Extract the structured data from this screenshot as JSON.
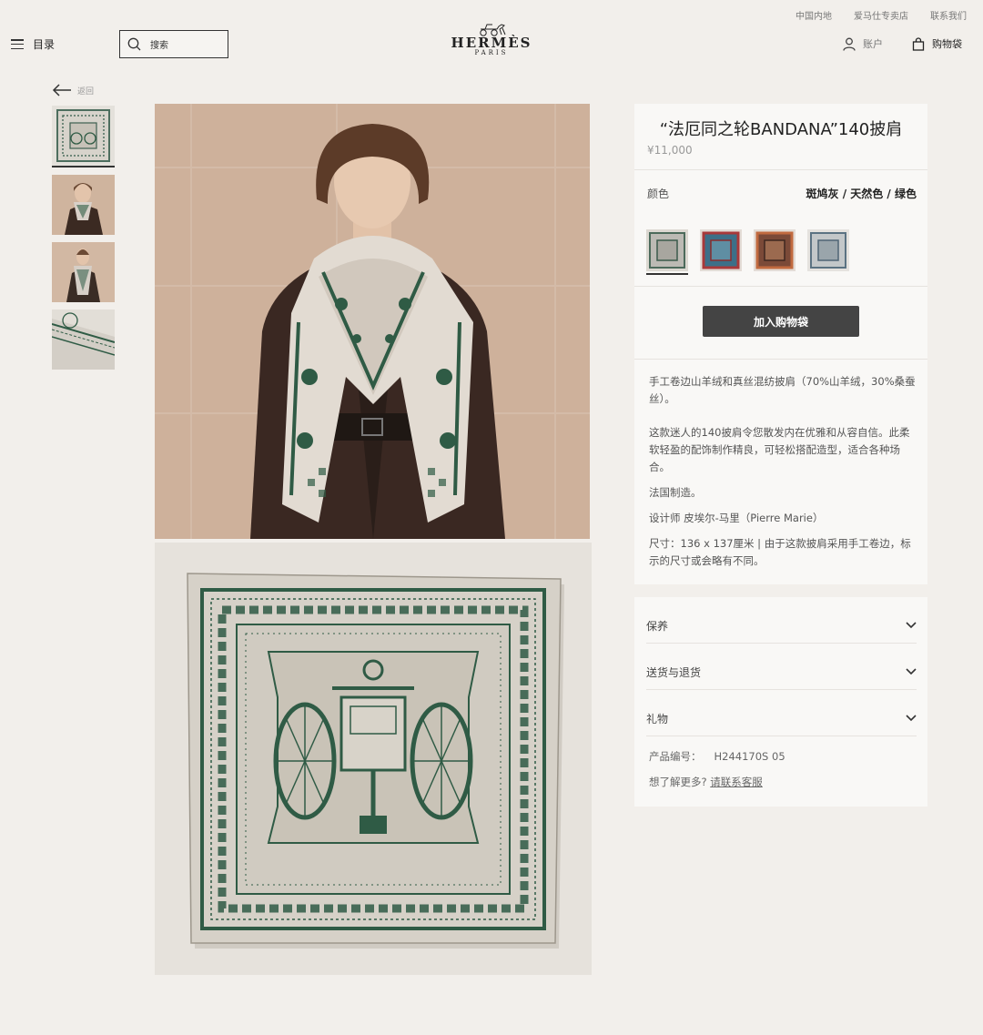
{
  "util_links": [
    "中国内地",
    "爱马仕专卖店",
    "联系我们"
  ],
  "header": {
    "menu_label": "目录",
    "search_placeholder": "搜索",
    "brand": "HERMÈS",
    "city": "PARIS",
    "account_label": "账户",
    "bag_label": "购物袋"
  },
  "back_label": "返回",
  "product": {
    "title": "“法厄同之轮BANDANA”140披肩",
    "price": "¥11,000",
    "color_label": "颜色",
    "color_value": "斑鸠灰 / 天然色 / 绿色",
    "add_to_bag": "加入购物袋",
    "desc1": "手工卷边山羊绒和真丝混纺披肩（70%山羊绒，30%桑蚕丝）。",
    "desc2": "这款迷人的140披肩令您散发内在优雅和从容自信。此柔软轻盈的配饰制作精良，可轻松搭配造型，适合各种场合。",
    "desc3": "法国制造。",
    "desc4": "设计师 皮埃尔-马里（Pierre Marie）",
    "desc5": "尺寸：136 x 137厘米 | 由于这款披肩采用手工卷边，标示的尺寸或会略有不同。"
  },
  "accordion": [
    "保养",
    "送货与退货",
    "礼物"
  ],
  "meta": {
    "code_label": "产品编号：",
    "code_value": "H244170S 05",
    "more_label": "想了解更多?",
    "contact_link": "请联系客服"
  },
  "colors": {
    "accent_dark": "#444444",
    "scarf_green": "#2f5b45",
    "background": "#f2efeb"
  }
}
